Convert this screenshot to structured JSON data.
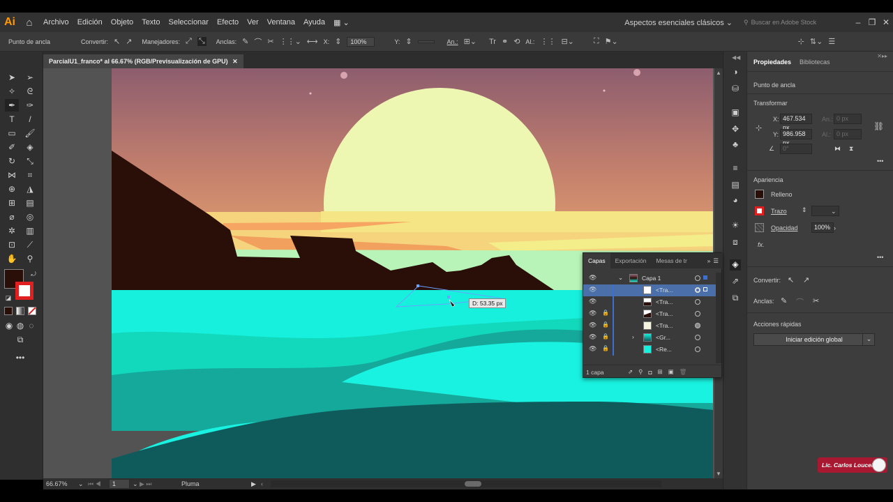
{
  "app": {
    "logo": "Ai",
    "home_icon": "home-icon"
  },
  "menu": [
    "Archivo",
    "Edición",
    "Objeto",
    "Texto",
    "Seleccionar",
    "Efecto",
    "Ver",
    "Ventana",
    "Ayuda"
  ],
  "workspace": "Aspectos esenciales clásicos",
  "search_placeholder": "Buscar en Adobe Stock",
  "control": {
    "mode": "Punto de ancla",
    "convert": "Convertir:",
    "handles": "Manejadores:",
    "anchors": "Anclas:",
    "x_label": "X:",
    "x_value": "100%",
    "y_label": "Y:",
    "an_label": "An.:",
    "al_label": "Al.:"
  },
  "document_tab": {
    "title": "ParcialU1_franco* al 66.67% (RGB/Previsualización de GPU)",
    "close": "✕"
  },
  "status": {
    "zoom": "66.67%",
    "artboard": "1",
    "tool": "Pluma"
  },
  "tooltip": "D: 53.35 px",
  "properties": {
    "tabs": [
      "Propiedades",
      "Bibliotecas"
    ],
    "selection": "Punto de ancla",
    "transform_title": "Transformar",
    "x_label": "X:",
    "x_value": "467.534 px",
    "y_label": "Y:",
    "y_value": "986.958 px",
    "w_label": "An.:",
    "w_value": "0 px",
    "h_label": "Al.:",
    "h_value": "0 px",
    "angle_value": "0°",
    "appearance_title": "Apariencia",
    "fill_label": "Relleno",
    "stroke_label": "Trazo",
    "opacity_label": "Opacidad",
    "opacity_value": "100%",
    "fx": "fx.",
    "convert_label": "Convertir:",
    "anchors_label": "Anclas:",
    "quick_actions_title": "Acciones rápidas",
    "global_edit_button": "Iniciar edición global"
  },
  "layers_panel": {
    "tabs": [
      "Capas",
      "Exportación",
      "Mesas de tr"
    ],
    "rows": [
      {
        "name": "Capa 1"
      },
      {
        "name": "<Tra..."
      },
      {
        "name": "<Tra..."
      },
      {
        "name": "<Tra..."
      },
      {
        "name": "<Tra..."
      },
      {
        "name": "<Gr..."
      },
      {
        "name": "<Re..."
      }
    ],
    "footer": "1 capa"
  },
  "watermark": "Lic. Carlos Loucel",
  "colors": {
    "fill": "#2a0e08",
    "accent": "#4b6fa8",
    "sun": "#eef7b2",
    "sea": "#14f2dc"
  }
}
